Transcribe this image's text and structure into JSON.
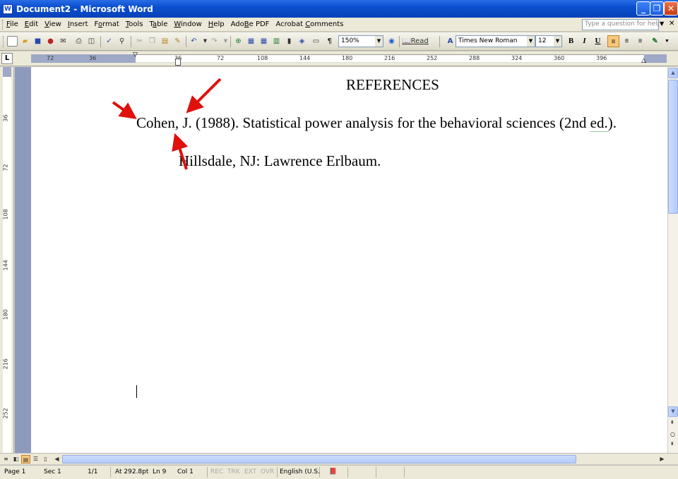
{
  "window": {
    "title": "Document2 - Microsoft Word",
    "app_icon": "word-document-icon",
    "controls": {
      "minimize": "_",
      "maximize": "❐",
      "close": "✕"
    }
  },
  "menubar": {
    "items": [
      {
        "label": "File",
        "ul": "F",
        "rest": "ile"
      },
      {
        "label": "Edit",
        "ul": "E",
        "rest": "dit"
      },
      {
        "label": "View",
        "ul": "V",
        "rest": "iew"
      },
      {
        "label": "Insert",
        "ul": "I",
        "rest": "nsert"
      },
      {
        "label": "Format",
        "ul": "o",
        "pre": "F",
        "rest": "rmat"
      },
      {
        "label": "Tools",
        "ul": "T",
        "rest": "ools"
      },
      {
        "label": "Table",
        "ul": "a",
        "pre": "T",
        "rest": "ble"
      },
      {
        "label": "Window",
        "ul": "W",
        "rest": "indow"
      },
      {
        "label": "Help",
        "ul": "H",
        "rest": "elp"
      },
      {
        "label": "Adobe PDF",
        "ul": "B",
        "pre": "Ado",
        "rest": "e PDF"
      },
      {
        "label": "Acrobat Comments",
        "ul": "C",
        "pre": "Acrobat ",
        "rest": "omments"
      }
    ],
    "help_placeholder": "Type a question for help"
  },
  "toolbar": {
    "zoom": "150%",
    "read_label": "Read",
    "font_name": "Times New Roman",
    "font_size": "12",
    "bold": "B",
    "italic": "I",
    "underline": "U"
  },
  "ruler": {
    "tab_selector": "L",
    "h_ticks": [
      "72",
      "36",
      "36",
      "72",
      "108",
      "144",
      "180",
      "216",
      "252",
      "288",
      "324",
      "360",
      "396"
    ],
    "v_ticks": [
      "36",
      "72",
      "108",
      "144",
      "180",
      "216",
      "252"
    ]
  },
  "document": {
    "heading": "REFERENCES",
    "line1_pre": "Cohen, J. (1988). Statistical power analysis for the behavioral sciences (2nd ",
    "line1_wavy": "ed.",
    "line1_post": ").",
    "line2": "Hillsdale, NJ: Lawrence Erlbaum."
  },
  "statusbar": {
    "page": "Page 1",
    "sec": "Sec 1",
    "pages": "1/1",
    "at": "At 292.8pt",
    "ln": "Ln 9",
    "col": "Col 1",
    "rec": "REC",
    "trk": "TRK",
    "ext": "EXT",
    "ovr": "OVR",
    "language": "English (U.S."
  },
  "colors": {
    "titlebar": "#0a4fd0",
    "arrow": "#e0100c",
    "page_bg": "#8c9bbc"
  }
}
